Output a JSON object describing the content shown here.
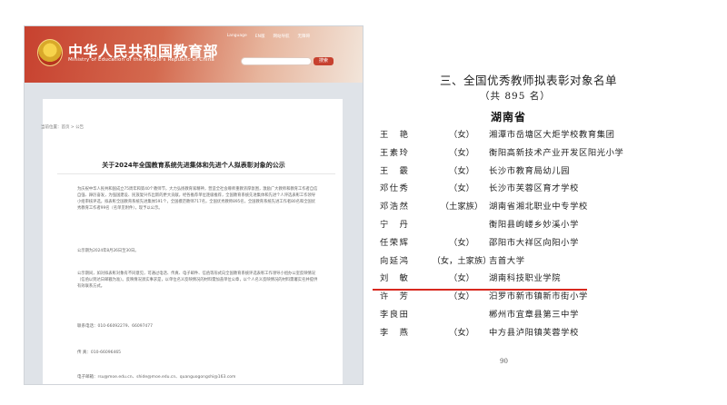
{
  "left": {
    "site_title": "中华人民共和国教育部",
    "site_subtitle": "Ministry of Education of the People's Republic of China",
    "top_links": [
      "Language",
      "EN版",
      "网站导航",
      "无障碍"
    ],
    "search_button": "搜索",
    "breadcrumb": "当前位置：首页 > 公告",
    "article_title": "关于2024年全国教育系统先进集体和先进个人拟表彰对象的公示",
    "para_1": "为庆祝中华人民共和国成立75周年和第40个教师节，大力弘扬教育家精神，营造全社会尊师重教浓厚氛围，激励广大教师和教育工作者自信自强、踔厉奋发，为强国建设、民族复兴作出新的更大贡献，经各推荐单位逐级推荐，全国教育系统先进集体和先进个人评选表彰工作领导小组审核评选，拟表彰全国教育系统先进集体591个，全国模范教师717名，全国优秀教师895名，全国教育系统先进工作者80名和全国优秀教育工作者99名（名单见附件），现予以公示。",
    "para_2": "公示期为2024年8月26日至30日。",
    "para_3": "公示期间，如对拟表彰对象有不同意见，可通过电话、传真、电子邮件、信函等形式向全国教育系统评选表彰工作领导小组办公室反映情况（信函以到达日邮戳为准）。反映情况须实事求是，以单位名义反映情况的材料需加盖单位公章，以个人名义反映情况的材料需署实名并提供有效联系方式。",
    "contact": "联系电话：010-66092279、66097477",
    "fax": "传 真：010-66096465",
    "email": "电子邮箱：rsu@moe.edu.cn、shide@moe.edu.cn、quanguogongshi@163.com"
  },
  "right": {
    "heading": "三、全国优秀教师拟表彰对象名单",
    "count": "（共 895 名）",
    "province": "湖南省",
    "rows": [
      {
        "name": "王　艳",
        "note": "（女）",
        "unit": "湘潭市岳塘区大炬学校教育集团"
      },
      {
        "name": "王素玲",
        "note": "（女）",
        "unit": "衡阳高新技术产业开发区阳光小学"
      },
      {
        "name": "王　霰",
        "note": "（女）",
        "unit": "长沙市教育局幼儿园"
      },
      {
        "name": "邓仕秀",
        "note": "（女）",
        "unit": "长沙市芙蓉区育才学校"
      },
      {
        "name": "邓浩然",
        "note": "（土家族）",
        "unit": "湖南省湘北职业中专学校"
      },
      {
        "name": "宁　丹",
        "note": "",
        "unit": "衡阳县岣嵝乡妙溪小学"
      },
      {
        "name": "任荣辉",
        "note": "（女）",
        "unit": "邵阳市大祥区向阳小学"
      },
      {
        "name": "向延鸿",
        "note": "（女，土家族）",
        "unit": "吉首大学"
      },
      {
        "name": "刘　敏",
        "note": "（女）",
        "unit": "湖南科技职业学院"
      },
      {
        "name": "许　芳",
        "note": "（女）",
        "unit": "汨罗市新市镇新市街小学"
      },
      {
        "name": "李良田",
        "note": "",
        "unit": "郴州市宜章县第三中学"
      },
      {
        "name": "李　燕",
        "note": "（女）",
        "unit": "中方县泸阳镇芙蓉学校"
      }
    ],
    "page_number": "90"
  }
}
